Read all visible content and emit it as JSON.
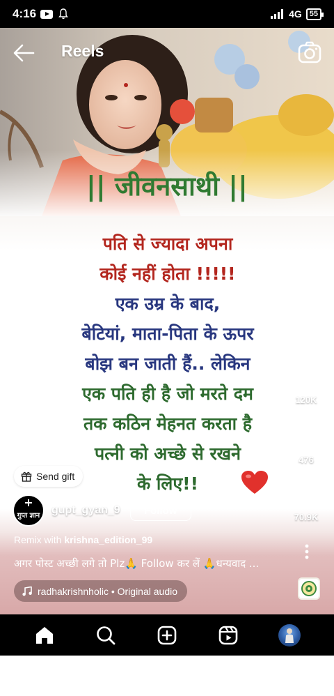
{
  "status_bar": {
    "time": "4:16",
    "network": "4G",
    "battery": "55"
  },
  "header": {
    "title": "Reels"
  },
  "post": {
    "title": "|| जीवनसाथी ||",
    "lines": [
      {
        "text": "पति से ज्यादा अपना",
        "color": "#b3261e"
      },
      {
        "text": "कोई नहीं होता !!!!!",
        "color": "#b3261e"
      },
      {
        "text": "एक उम्र के बाद,",
        "color": "#28377f"
      },
      {
        "text": "बेटियां, माता-पिता के ऊपर",
        "color": "#28377f"
      },
      {
        "text": "बोझ बन जाती हैं.. लेकिन",
        "color": "#28377f"
      },
      {
        "text": "एक पति ही है जो मरते दम",
        "color": "#2d6a2e"
      },
      {
        "text": "तक कठिन मेहनत करता है",
        "color": "#2d6a2e"
      },
      {
        "text": "पत्नी को अच्छे से रखने",
        "color": "#2d6a2e"
      },
      {
        "text": "के लिए!!",
        "color": "#2d6a2e"
      }
    ],
    "heart_emoji": "red-heart"
  },
  "actions": {
    "likes": "120K",
    "comments": "476",
    "shares": "70.9K"
  },
  "overlay": {
    "send_gift_label": "Send gift",
    "avatar_text": "गुप्त ज्ञान",
    "username": "gupt_gyan_9",
    "follow_label": "Follow",
    "remix_prefix": "Remix with ",
    "remix_user": "krishna_edition_99",
    "caption": "अगर पोस्ट अच्छी लगे तो Plz🙏 Follow कर लें 🙏धन्यवाद ...",
    "audio": "radhakrishnholic • Original audio"
  },
  "nav": {
    "items": [
      "home-icon",
      "search-icon",
      "create-icon",
      "reels-icon",
      "profile-avatar"
    ]
  },
  "colors": {
    "title_green": "#2f7a31",
    "poem_red": "#b3261e",
    "poem_blue": "#28377f",
    "poem_green": "#2d6a2e"
  }
}
